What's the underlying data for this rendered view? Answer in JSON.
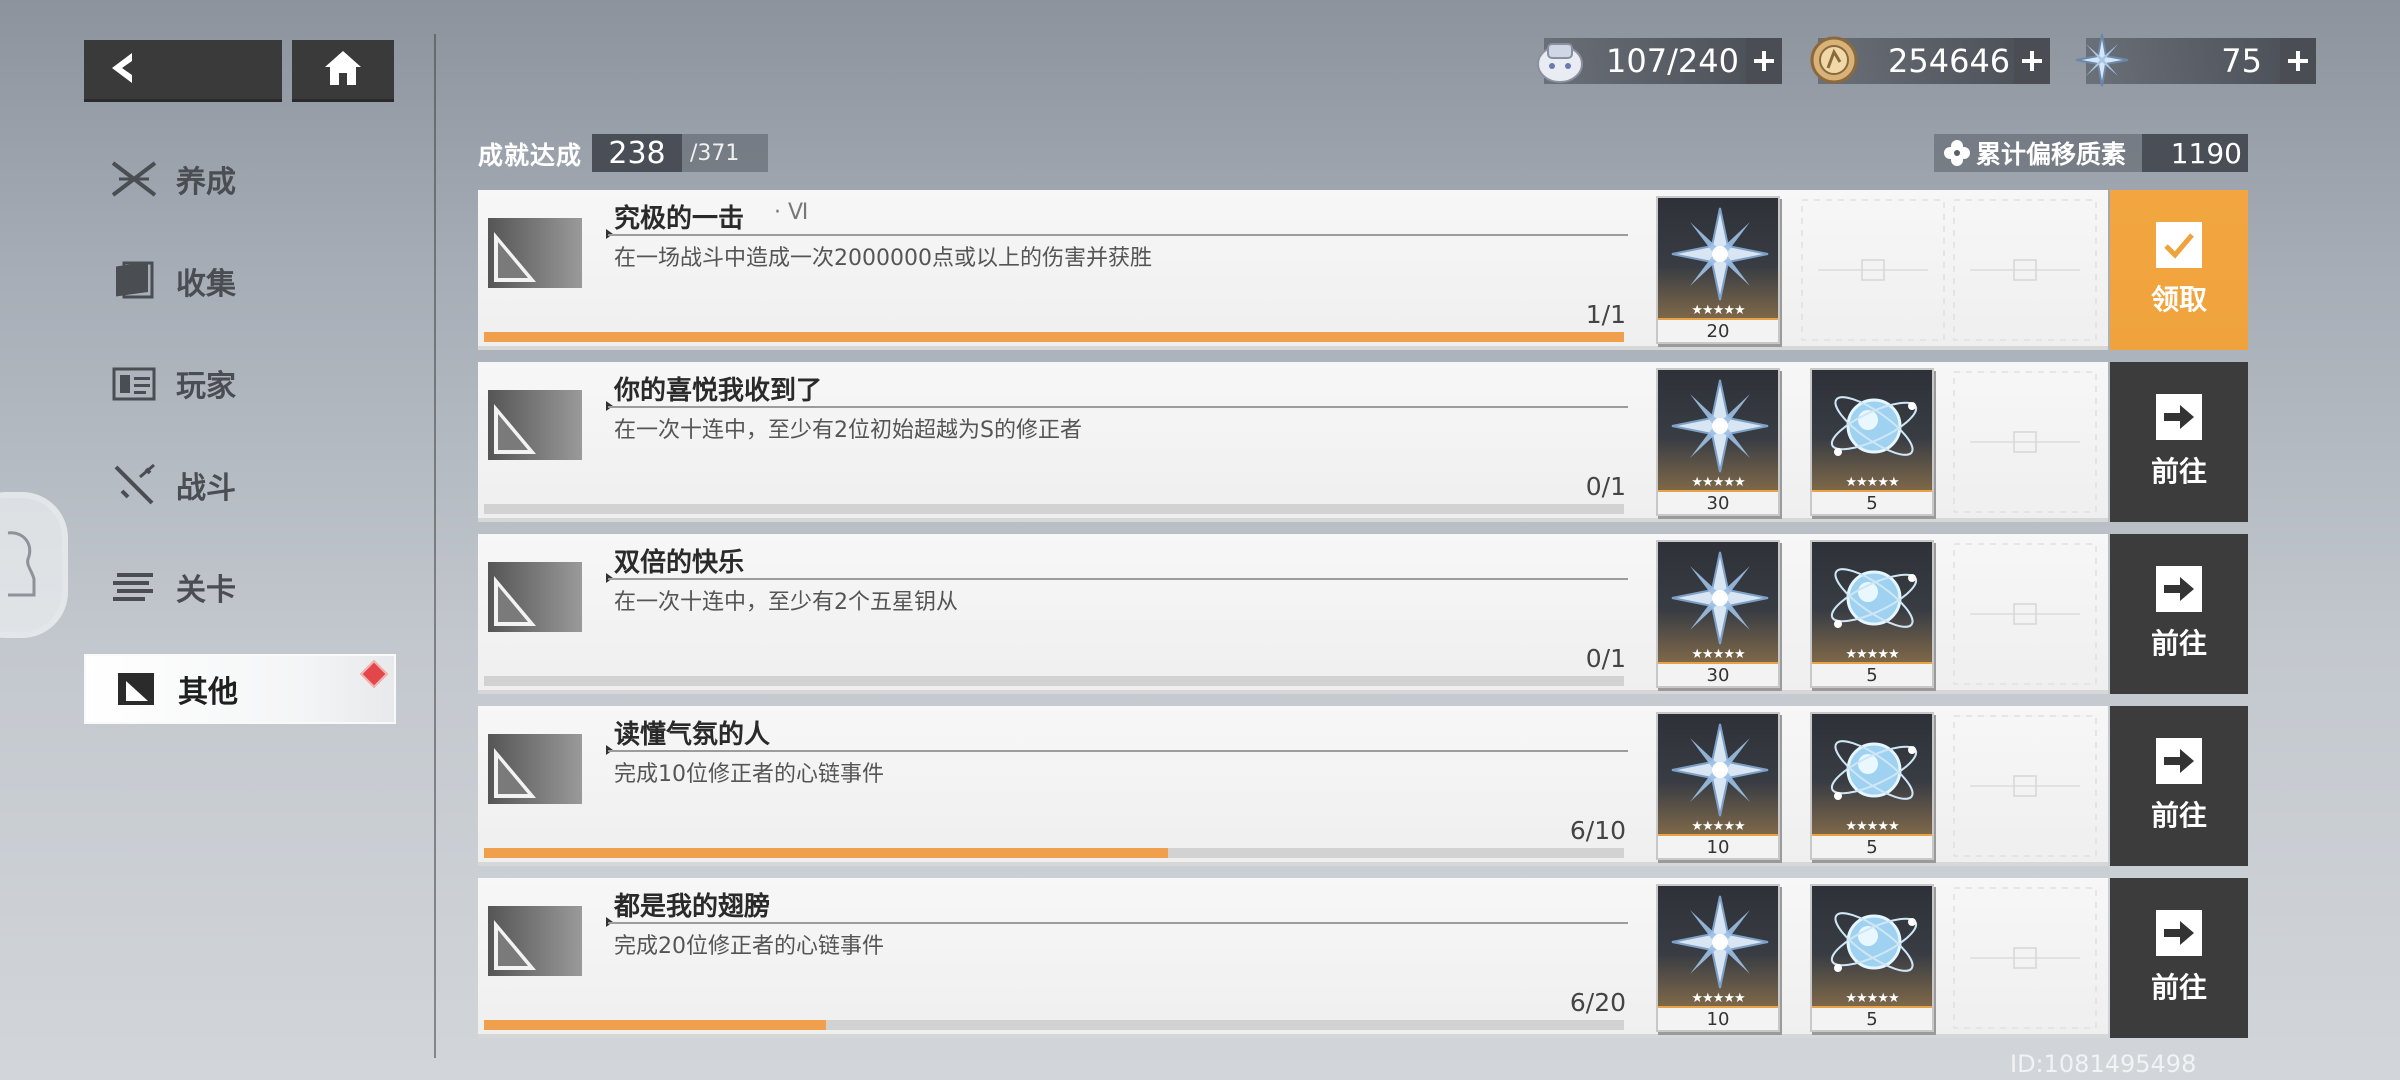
{
  "nav": {
    "items": [
      {
        "label": "养成",
        "icon": "cultivate-icon"
      },
      {
        "label": "收集",
        "icon": "collect-icon"
      },
      {
        "label": "玩家",
        "icon": "player-icon"
      },
      {
        "label": "战斗",
        "icon": "battle-icon"
      },
      {
        "label": "关卡",
        "icon": "stage-icon"
      },
      {
        "label": "其他",
        "icon": "other-icon",
        "active": true,
        "badge": true
      }
    ]
  },
  "resources": {
    "stamina": {
      "value": "107/240",
      "icon": "stamina-icon"
    },
    "coins": {
      "value": "254646",
      "icon": "coin-icon"
    },
    "crystal": {
      "value": "75",
      "icon": "crystal-icon"
    }
  },
  "achievement": {
    "label": "成就达成",
    "done": "238",
    "total": "/371"
  },
  "offset_element": {
    "label": "累计偏移质素",
    "value": "1190"
  },
  "rows": [
    {
      "title": "究极的一击",
      "subtitle": "· Ⅵ",
      "desc": "在一场战斗中造成一次2000000点或以上的伤害并获胜",
      "progress": "1/1",
      "ratio": 1.0,
      "rewards": [
        {
          "item": "crystal",
          "count": "20",
          "stars": "★★★★★"
        }
      ],
      "action": {
        "type": "claim",
        "label": "领取"
      }
    },
    {
      "title": "你的喜悦我收到了",
      "subtitle": "",
      "desc": "在一次十连中，至少有2位初始超越为S的修正者",
      "progress": "0/1",
      "ratio": 0.0,
      "rewards": [
        {
          "item": "crystal",
          "count": "30",
          "stars": "★★★★★"
        },
        {
          "item": "orb",
          "count": "5",
          "stars": "★★★★★"
        }
      ],
      "action": {
        "type": "go",
        "label": "前往"
      }
    },
    {
      "title": "双倍的快乐",
      "subtitle": "",
      "desc": "在一次十连中，至少有2个五星钥从",
      "progress": "0/1",
      "ratio": 0.0,
      "rewards": [
        {
          "item": "crystal",
          "count": "30",
          "stars": "★★★★★"
        },
        {
          "item": "orb",
          "count": "5",
          "stars": "★★★★★"
        }
      ],
      "action": {
        "type": "go",
        "label": "前往"
      }
    },
    {
      "title": "读懂气氛的人",
      "subtitle": "",
      "desc": "完成10位修正者的心链事件",
      "progress": "6/10",
      "ratio": 0.6,
      "rewards": [
        {
          "item": "crystal",
          "count": "10",
          "stars": "★★★★★"
        },
        {
          "item": "orb",
          "count": "5",
          "stars": "★★★★★"
        }
      ],
      "action": {
        "type": "go",
        "label": "前往"
      }
    },
    {
      "title": "都是我的翅膀",
      "subtitle": "",
      "desc": "完成20位修正者的心链事件",
      "progress": "6/20",
      "ratio": 0.3,
      "rewards": [
        {
          "item": "crystal",
          "count": "10",
          "stars": "★★★★★"
        },
        {
          "item": "orb",
          "count": "5",
          "stars": "★★★★★"
        }
      ],
      "action": {
        "type": "go",
        "label": "前往"
      }
    }
  ],
  "footer": {
    "id_text": "ID:1081495498"
  },
  "colors": {
    "accent_orange": "#f0a33c",
    "progress_fill": "#f0a04c",
    "dark_panel": "#3c3c3c",
    "badge_red": "#e3474a"
  }
}
